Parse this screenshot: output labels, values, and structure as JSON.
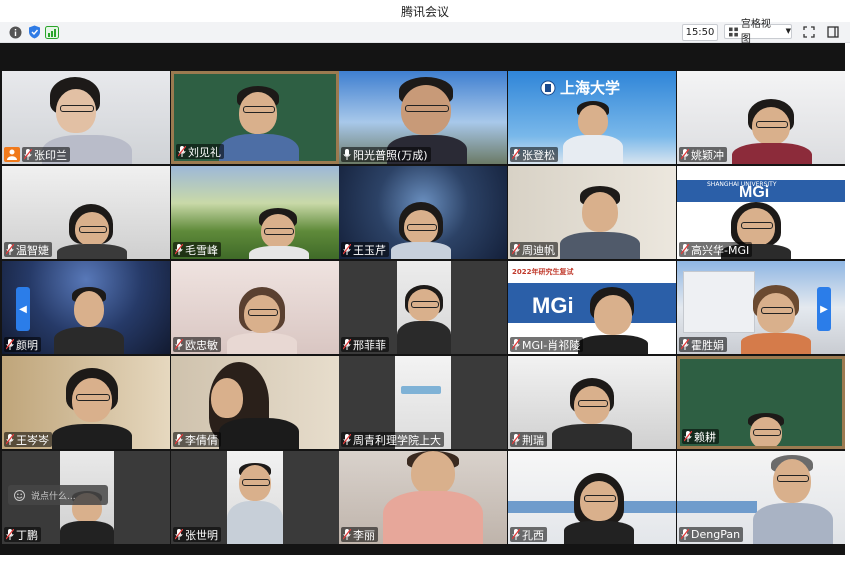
{
  "window": {
    "title": "腾讯会议"
  },
  "toolbar": {
    "time": "15:50",
    "view_mode": "宫格视图",
    "icons": [
      "info-icon",
      "shield-icon",
      "signal-icon",
      "fullscreen-icon",
      "sidebar-toggle-icon"
    ]
  },
  "chat": {
    "placeholder": "说点什么..."
  },
  "banners": {
    "shu_logo": "上海大学",
    "mgi_text": "MGi",
    "shu_en": "SHANGHAI UNIVERSITY",
    "mgi_slide_title": "2022年研究生复试"
  },
  "participants": [
    {
      "name": "张印兰",
      "host": true
    },
    {
      "name": "刘见礼"
    },
    {
      "name": "阳光普照(万成)",
      "speaking": true
    },
    {
      "name": "张登松"
    },
    {
      "name": "姚颖冲"
    },
    {
      "name": "温智婕"
    },
    {
      "name": "毛雪峰"
    },
    {
      "name": "王玉芹"
    },
    {
      "name": "周迪帆"
    },
    {
      "name": "高兴华-MGI"
    },
    {
      "name": "颜明"
    },
    {
      "name": "欧忠敏"
    },
    {
      "name": "邢菲菲"
    },
    {
      "name": "MGI-肖祁陵"
    },
    {
      "name": "霍胜娟"
    },
    {
      "name": "王岑岑"
    },
    {
      "name": "李倩倩"
    },
    {
      "name": "周青利理学院上大"
    },
    {
      "name": "荆瑞"
    },
    {
      "name": "赖耕"
    },
    {
      "name": "丁鹏"
    },
    {
      "name": "张世明"
    },
    {
      "name": "李丽"
    },
    {
      "name": "孔西"
    },
    {
      "name": "DengPan"
    }
  ]
}
